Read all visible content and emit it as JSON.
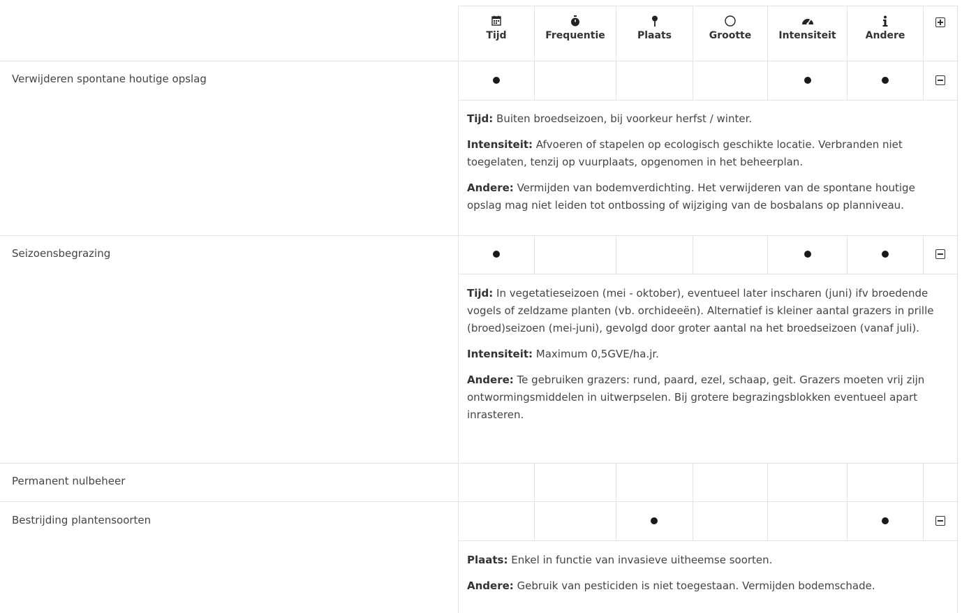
{
  "columns": [
    {
      "key": "tijd",
      "label": "Tijd",
      "icon": "calendar-icon"
    },
    {
      "key": "frequentie",
      "label": "Frequentie",
      "icon": "stopwatch-icon"
    },
    {
      "key": "plaats",
      "label": "Plaats",
      "icon": "map-pin-icon"
    },
    {
      "key": "grootte",
      "label": "Grootte",
      "icon": "circle-icon"
    },
    {
      "key": "intensiteit",
      "label": "Intensiteit",
      "icon": "gauge-icon"
    },
    {
      "key": "andere",
      "label": "Andere",
      "icon": "info-icon"
    }
  ],
  "rows": [
    {
      "label": "Verwijderen spontane houtige opslag",
      "marks": [
        true,
        false,
        false,
        false,
        true,
        true
      ],
      "expanded": true,
      "details": [
        {
          "term": "Tijd:",
          "text": "Buiten broedseizoen, bij voorkeur herfst / winter."
        },
        {
          "term": "Intensiteit:",
          "text": "Afvoeren of stapelen op ecologisch geschikte locatie. Verbranden niet toegelaten, tenzij op vuurplaats, opgenomen in het beheerplan."
        },
        {
          "term": "Andere:",
          "text": "Vermijden van bodemverdichting. Het verwijderen van de spontane houtige opslag mag niet leiden tot ontbossing of wijziging van de bosbalans op planniveau."
        }
      ]
    },
    {
      "label": "Seizoensbegrazing",
      "marks": [
        true,
        false,
        false,
        false,
        true,
        true
      ],
      "expanded": true,
      "details": [
        {
          "term": "Tijd:",
          "text": "In vegetatieseizoen (mei - oktober), eventueel later inscharen (juni) ifv broedende vogels of zeldzame planten (vb. orchideeën). Alternatief is kleiner aantal grazers in prille (broed)seizoen (mei-juni), gevolgd door groter aantal na het broedseizoen (vanaf juli)."
        },
        {
          "term": "Intensiteit:",
          "text": "Maximum 0,5GVE/ha.jr."
        },
        {
          "term": "Andere:",
          "text": "Te gebruiken grazers: rund, paard, ezel, schaap, geit. Grazers moeten vrij zijn ontwormingsmiddelen in uitwerpselen. Bij grotere begrazingsblokken eventueel apart inrasteren."
        }
      ]
    },
    {
      "label": "Permanent nulbeheer",
      "marks": [
        false,
        false,
        false,
        false,
        false,
        false
      ],
      "expanded": false,
      "details": []
    },
    {
      "label": "Bestrijding plantensoorten",
      "marks": [
        false,
        false,
        true,
        false,
        false,
        true
      ],
      "expanded": true,
      "details": [
        {
          "term": "Plaats:",
          "text": "Enkel in functie van invasieve uitheemse soorten."
        },
        {
          "term": "Andere:",
          "text": "Gebruik van pesticiden is niet toegestaan. Vermijden bodemschade."
        }
      ]
    }
  ]
}
